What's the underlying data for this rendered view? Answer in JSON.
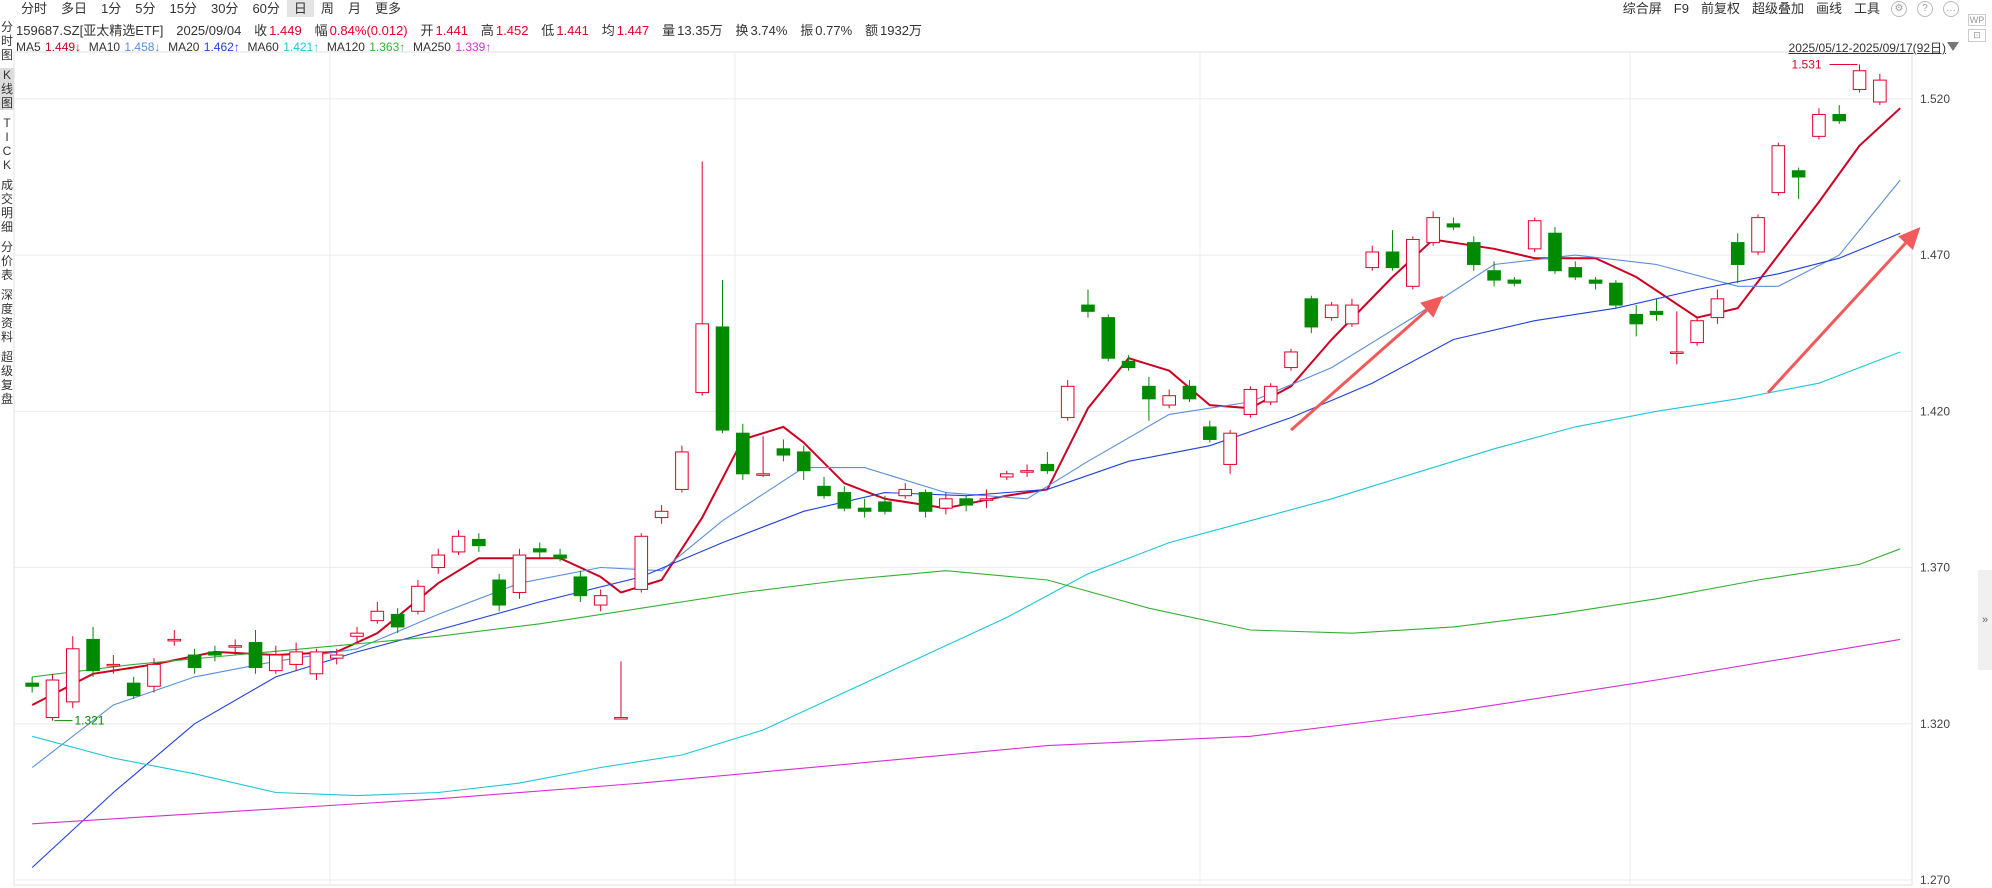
{
  "period_tabs": [
    "分时",
    "多日",
    "1分",
    "5分",
    "15分",
    "30分",
    "60分",
    "日",
    "周",
    "月",
    "更多"
  ],
  "active_tab": "日",
  "right_tools": [
    "综合屏",
    "F9",
    "前复权",
    "超级叠加",
    "画线",
    "工具"
  ],
  "sidebar": [
    {
      "label": "分时图",
      "active": false
    },
    {
      "label": "K线图",
      "active": true
    },
    {
      "label": "TICK",
      "active": false
    },
    {
      "label": "成交明细",
      "active": false
    },
    {
      "label": "分价表",
      "active": false
    },
    {
      "label": "深度资料",
      "active": false
    },
    {
      "label": "超级复盘",
      "active": false
    }
  ],
  "quote": {
    "symbol": "159687.SZ[亚太精选ETF]",
    "date": "2025/09/04",
    "close_label": "收",
    "close": "1.449",
    "change_label": "幅",
    "change": "0.84%(0.012)",
    "open_label": "开",
    "open": "1.441",
    "high_label": "高",
    "high": "1.452",
    "low_label": "低",
    "low": "1.441",
    "avg_label": "均",
    "avg": "1.447",
    "volume_label": "量",
    "volume": "13.35万",
    "turnover_label": "换",
    "turnover": "3.74%",
    "amplitude_label": "振",
    "amplitude": "0.77%",
    "amount_label": "额",
    "amount": "1932万"
  },
  "ma_legend": [
    {
      "name": "MA5",
      "value": "1.449↓",
      "color": "#cc0022"
    },
    {
      "name": "MA10",
      "value": "1.458↓",
      "color": "#5a8ed8"
    },
    {
      "name": "MA20",
      "value": "1.462↑",
      "color": "#1f3fe0"
    },
    {
      "name": "MA60",
      "value": "1.421↑",
      "color": "#1cc6d8"
    },
    {
      "name": "MA120",
      "value": "1.363↑",
      "color": "#33b033"
    },
    {
      "name": "MA250",
      "value": "1.339↑",
      "color": "#d62ed6"
    }
  ],
  "range_label": "2025/05/12-2025/09/17(92日)",
  "colors": {
    "up": "#e4002b",
    "down": "#008a00",
    "grid": "#e6e6e6",
    "annotation": "#f05a5a"
  },
  "chart_data": {
    "type": "candlestick",
    "ylim": [
      1.27,
      1.535
    ],
    "yticks": [
      "1.270",
      "1.320",
      "1.370",
      "1.420",
      "1.470",
      "1.520"
    ],
    "high_marker": "1.531",
    "low_marker": "1.321",
    "candles": [
      [
        1.333,
        1.332,
        1.335,
        1.33
      ],
      [
        1.322,
        1.334,
        1.336,
        1.321
      ],
      [
        1.327,
        1.344,
        1.348,
        1.325
      ],
      [
        1.347,
        1.337,
        1.351,
        1.335
      ],
      [
        1.339,
        1.339,
        1.342,
        1.336
      ],
      [
        1.333,
        1.329,
        1.335,
        1.328
      ],
      [
        1.332,
        1.339,
        1.341,
        1.33
      ],
      [
        1.347,
        1.347,
        1.35,
        1.345
      ],
      [
        1.342,
        1.338,
        1.344,
        1.336
      ],
      [
        1.343,
        1.342,
        1.345,
        1.34
      ],
      [
        1.345,
        1.345,
        1.347,
        1.342
      ],
      [
        1.346,
        1.338,
        1.35,
        1.336
      ],
      [
        1.337,
        1.342,
        1.345,
        1.336
      ],
      [
        1.339,
        1.343,
        1.346,
        1.337
      ],
      [
        1.336,
        1.343,
        1.344,
        1.334
      ],
      [
        1.341,
        1.342,
        1.344,
        1.339
      ],
      [
        1.348,
        1.349,
        1.351,
        1.346
      ],
      [
        1.353,
        1.356,
        1.359,
        1.352
      ],
      [
        1.355,
        1.351,
        1.357,
        1.349
      ],
      [
        1.356,
        1.364,
        1.366,
        1.355
      ],
      [
        1.37,
        1.374,
        1.376,
        1.368
      ],
      [
        1.375,
        1.38,
        1.382,
        1.374
      ],
      [
        1.379,
        1.377,
        1.381,
        1.375
      ],
      [
        1.366,
        1.358,
        1.368,
        1.356
      ],
      [
        1.362,
        1.374,
        1.376,
        1.36
      ],
      [
        1.376,
        1.375,
        1.378,
        1.373
      ],
      [
        1.374,
        1.373,
        1.376,
        1.372
      ],
      [
        1.367,
        1.361,
        1.369,
        1.359
      ],
      [
        1.358,
        1.361,
        1.363,
        1.356
      ],
      [
        1.322,
        1.322,
        1.34,
        1.322
      ],
      [
        1.363,
        1.38,
        1.381,
        1.362
      ],
      [
        1.386,
        1.388,
        1.39,
        1.384
      ],
      [
        1.395,
        1.407,
        1.409,
        1.394
      ],
      [
        1.426,
        1.448,
        1.5,
        1.425
      ],
      [
        1.447,
        1.414,
        1.462,
        1.413
      ],
      [
        1.413,
        1.4,
        1.416,
        1.398
      ],
      [
        1.4,
        1.4,
        1.412,
        1.399
      ],
      [
        1.408,
        1.406,
        1.411,
        1.404
      ],
      [
        1.407,
        1.401,
        1.409,
        1.398
      ],
      [
        1.396,
        1.393,
        1.399,
        1.392
      ],
      [
        1.394,
        1.389,
        1.396,
        1.388
      ],
      [
        1.389,
        1.388,
        1.392,
        1.386
      ],
      [
        1.391,
        1.388,
        1.393,
        1.387
      ],
      [
        1.393,
        1.395,
        1.397,
        1.392
      ],
      [
        1.394,
        1.388,
        1.395,
        1.386
      ],
      [
        1.389,
        1.392,
        1.394,
        1.387
      ],
      [
        1.392,
        1.39,
        1.393,
        1.388
      ],
      [
        1.392,
        1.392,
        1.395,
        1.389
      ],
      [
        1.399,
        1.4,
        1.401,
        1.398
      ],
      [
        1.401,
        1.401,
        1.403,
        1.399
      ],
      [
        1.403,
        1.401,
        1.407,
        1.4
      ],
      [
        1.418,
        1.428,
        1.43,
        1.417
      ],
      [
        1.454,
        1.452,
        1.459,
        1.45
      ],
      [
        1.45,
        1.437,
        1.451,
        1.436
      ],
      [
        1.436,
        1.434,
        1.438,
        1.433
      ],
      [
        1.428,
        1.424,
        1.431,
        1.417
      ],
      [
        1.422,
        1.425,
        1.427,
        1.421
      ],
      [
        1.428,
        1.424,
        1.43,
        1.423
      ],
      [
        1.415,
        1.411,
        1.417,
        1.41
      ],
      [
        1.403,
        1.413,
        1.414,
        1.4
      ],
      [
        1.419,
        1.427,
        1.428,
        1.418
      ],
      [
        1.423,
        1.428,
        1.429,
        1.422
      ],
      [
        1.434,
        1.439,
        1.44,
        1.433
      ],
      [
        1.456,
        1.447,
        1.457,
        1.445
      ],
      [
        1.45,
        1.454,
        1.455,
        1.449
      ],
      [
        1.448,
        1.454,
        1.456,
        1.447
      ],
      [
        1.466,
        1.471,
        1.473,
        1.465
      ],
      [
        1.471,
        1.466,
        1.478,
        1.465
      ],
      [
        1.46,
        1.475,
        1.476,
        1.459
      ],
      [
        1.474,
        1.482,
        1.484,
        1.473
      ],
      [
        1.48,
        1.479,
        1.482,
        1.478
      ],
      [
        1.474,
        1.467,
        1.476,
        1.465
      ],
      [
        1.465,
        1.462,
        1.468,
        1.46
      ],
      [
        1.462,
        1.461,
        1.463,
        1.46
      ],
      [
        1.472,
        1.481,
        1.482,
        1.471
      ],
      [
        1.477,
        1.465,
        1.479,
        1.464
      ],
      [
        1.466,
        1.463,
        1.468,
        1.462
      ],
      [
        1.462,
        1.461,
        1.463,
        1.459
      ],
      [
        1.461,
        1.454,
        1.462,
        1.453
      ],
      [
        1.451,
        1.448,
        1.454,
        1.444
      ],
      [
        1.452,
        1.451,
        1.456,
        1.449
      ],
      [
        1.439,
        1.439,
        1.452,
        1.435
      ],
      [
        1.442,
        1.449,
        1.45,
        1.441
      ],
      [
        1.45,
        1.456,
        1.459,
        1.448
      ],
      [
        1.474,
        1.467,
        1.477,
        1.461
      ],
      [
        1.471,
        1.482,
        1.483,
        1.47
      ],
      [
        1.49,
        1.505,
        1.506,
        1.489
      ],
      [
        1.497,
        1.495,
        1.498,
        1.488
      ],
      [
        1.508,
        1.515,
        1.517,
        1.507
      ],
      [
        1.515,
        1.513,
        1.518,
        1.512
      ],
      [
        1.523,
        1.529,
        1.531,
        1.522
      ],
      [
        1.519,
        1.526,
        1.528,
        1.518
      ]
    ],
    "ma": {
      "MA5": [
        [
          0,
          1.326
        ],
        [
          3,
          1.336
        ],
        [
          6,
          1.339
        ],
        [
          9,
          1.343
        ],
        [
          12,
          1.342
        ],
        [
          15,
          1.343
        ],
        [
          17,
          1.349
        ],
        [
          20,
          1.365
        ],
        [
          22,
          1.373
        ],
        [
          26,
          1.373
        ],
        [
          28,
          1.367
        ],
        [
          29,
          1.362
        ],
        [
          31,
          1.366
        ],
        [
          33,
          1.386
        ],
        [
          35,
          1.411
        ],
        [
          37,
          1.415
        ],
        [
          38,
          1.41
        ],
        [
          40,
          1.397
        ],
        [
          42,
          1.392
        ],
        [
          45,
          1.389
        ],
        [
          48,
          1.393
        ],
        [
          50,
          1.395
        ],
        [
          52,
          1.421
        ],
        [
          54,
          1.437
        ],
        [
          56,
          1.433
        ],
        [
          58,
          1.422
        ],
        [
          60,
          1.421
        ],
        [
          62,
          1.428
        ],
        [
          64,
          1.443
        ],
        [
          67,
          1.463
        ],
        [
          69,
          1.475
        ],
        [
          72,
          1.472
        ],
        [
          74,
          1.469
        ],
        [
          77,
          1.469
        ],
        [
          79,
          1.463
        ],
        [
          82,
          1.45
        ],
        [
          84,
          1.453
        ],
        [
          86,
          1.47
        ],
        [
          88,
          1.487
        ],
        [
          90,
          1.505
        ],
        [
          92,
          1.517
        ]
      ],
      "MA10": [
        [
          0,
          1.306
        ],
        [
          4,
          1.326
        ],
        [
          8,
          1.335
        ],
        [
          12,
          1.34
        ],
        [
          16,
          1.344
        ],
        [
          20,
          1.355
        ],
        [
          24,
          1.365
        ],
        [
          28,
          1.37
        ],
        [
          31,
          1.369
        ],
        [
          34,
          1.385
        ],
        [
          38,
          1.402
        ],
        [
          41,
          1.402
        ],
        [
          45,
          1.394
        ],
        [
          49,
          1.392
        ],
        [
          52,
          1.404
        ],
        [
          56,
          1.419
        ],
        [
          60,
          1.423
        ],
        [
          64,
          1.434
        ],
        [
          68,
          1.45
        ],
        [
          72,
          1.467
        ],
        [
          76,
          1.47
        ],
        [
          80,
          1.467
        ],
        [
          84,
          1.46
        ],
        [
          86,
          1.46
        ],
        [
          89,
          1.47
        ],
        [
          92,
          1.494
        ]
      ],
      "MA20": [
        [
          0,
          1.274
        ],
        [
          4,
          1.298
        ],
        [
          8,
          1.32
        ],
        [
          12,
          1.335
        ],
        [
          16,
          1.343
        ],
        [
          20,
          1.35
        ],
        [
          25,
          1.359
        ],
        [
          30,
          1.367
        ],
        [
          34,
          1.378
        ],
        [
          38,
          1.388
        ],
        [
          42,
          1.394
        ],
        [
          46,
          1.393
        ],
        [
          50,
          1.395
        ],
        [
          54,
          1.404
        ],
        [
          58,
          1.409
        ],
        [
          62,
          1.418
        ],
        [
          66,
          1.429
        ],
        [
          70,
          1.443
        ],
        [
          74,
          1.449
        ],
        [
          78,
          1.453
        ],
        [
          82,
          1.459
        ],
        [
          86,
          1.464
        ],
        [
          89,
          1.469
        ],
        [
          92,
          1.477
        ]
      ],
      "MA60": [
        [
          0,
          1.316
        ],
        [
          4,
          1.309
        ],
        [
          8,
          1.304
        ],
        [
          12,
          1.298
        ],
        [
          16,
          1.297
        ],
        [
          20,
          1.298
        ],
        [
          24,
          1.301
        ],
        [
          28,
          1.306
        ],
        [
          32,
          1.31
        ],
        [
          36,
          1.318
        ],
        [
          40,
          1.33
        ],
        [
          44,
          1.342
        ],
        [
          48,
          1.354
        ],
        [
          52,
          1.368
        ],
        [
          56,
          1.378
        ],
        [
          60,
          1.385
        ],
        [
          64,
          1.392
        ],
        [
          68,
          1.4
        ],
        [
          72,
          1.408
        ],
        [
          76,
          1.415
        ],
        [
          80,
          1.42
        ],
        [
          84,
          1.424
        ],
        [
          88,
          1.429
        ],
        [
          92,
          1.439
        ]
      ],
      "MA120": [
        [
          0,
          1.335
        ],
        [
          5,
          1.339
        ],
        [
          10,
          1.342
        ],
        [
          15,
          1.345
        ],
        [
          20,
          1.348
        ],
        [
          25,
          1.352
        ],
        [
          30,
          1.357
        ],
        [
          35,
          1.362
        ],
        [
          40,
          1.366
        ],
        [
          45,
          1.369
        ],
        [
          50,
          1.366
        ],
        [
          55,
          1.357
        ],
        [
          60,
          1.35
        ],
        [
          65,
          1.349
        ],
        [
          70,
          1.351
        ],
        [
          75,
          1.355
        ],
        [
          80,
          1.36
        ],
        [
          85,
          1.366
        ],
        [
          90,
          1.371
        ],
        [
          92,
          1.376
        ]
      ],
      "MA250": [
        [
          0,
          1.288
        ],
        [
          10,
          1.292
        ],
        [
          20,
          1.296
        ],
        [
          30,
          1.301
        ],
        [
          40,
          1.307
        ],
        [
          50,
          1.313
        ],
        [
          60,
          1.316
        ],
        [
          70,
          1.324
        ],
        [
          80,
          1.334
        ],
        [
          92,
          1.347
        ]
      ]
    },
    "annotations": [
      {
        "type": "arrow",
        "from": [
          62.0,
          1.414
        ],
        "to": [
          69.5,
          1.457
        ]
      },
      {
        "type": "arrow",
        "from": [
          85.5,
          1.426
        ],
        "to": [
          93.0,
          1.479
        ]
      }
    ]
  }
}
